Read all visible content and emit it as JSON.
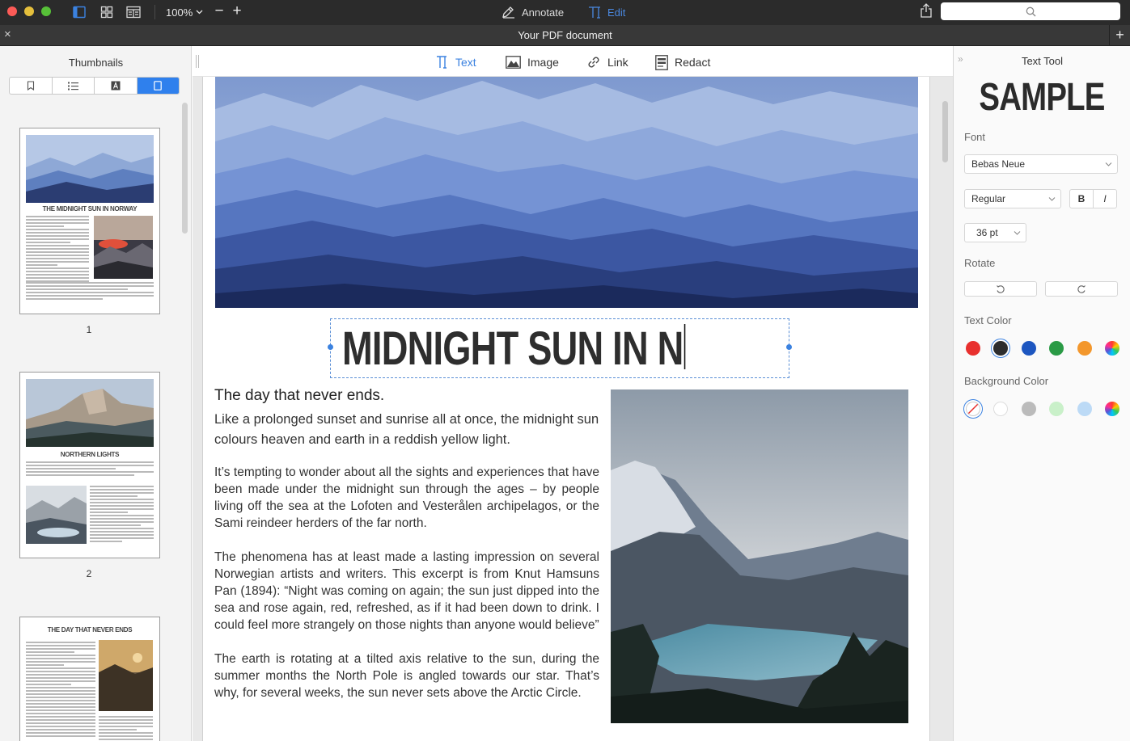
{
  "toolbar": {
    "zoom": "100%",
    "annotate_label": "Annotate",
    "edit_label": "Edit"
  },
  "tabbar": {
    "document_title": "Your PDF document"
  },
  "sidebar": {
    "title": "Thumbnails",
    "thumbnails": [
      {
        "number": "1",
        "heading": "THE MIDNIGHT SUN IN NORWAY"
      },
      {
        "number": "2",
        "heading": "NORTHERN LIGHTS"
      },
      {
        "heading": "THE DAY THAT NEVER ENDS"
      }
    ]
  },
  "edit_tools": {
    "text": "Text",
    "image": "Image",
    "link": "Link",
    "redact": "Redact"
  },
  "document": {
    "headline": "MIDNIGHT SUN IN N",
    "subheading": "The day that never ends.",
    "lead": "Like a prolonged sunset and sunrise all at once, the midnight sun colours heaven and earth in a reddish yellow light.",
    "paragraphs": [
      "It’s tempting to wonder about all the sights and experiences that have been made under the midnight sun through the ages – by people living off the sea at the Lofoten and Vesterålen archipelagos, or the Sami reindeer herders of the far north.",
      "The phenomena has at least made a lasting impression on several Norwegian artists and writers. This excerpt is from Knut Hamsuns Pan (1894): “Night was coming on again; the sun just dipped into the sea and rose again, red, refreshed, as if it had been down to drink. I could feel more strangely on those nights than anyone would believe”",
      "The earth is rotating at a tilted axis relative to the sun, during the summer months the North Pole is angled towards our star. That’s why, for several weeks, the sun never sets above the Arctic Circle."
    ]
  },
  "text_tool": {
    "title": "Text Tool",
    "sample": "SAMPLE",
    "font_label": "Font",
    "font_value": "Bebas Neue",
    "style_value": "Regular",
    "bold_label": "B",
    "italic_label": "I",
    "size_value": "36 pt",
    "rotate_label": "Rotate",
    "text_color_label": "Text Color",
    "background_color_label": "Background Color",
    "text_colors": [
      "#e8302e",
      "#2d2d2d",
      "#1d56c0",
      "#2a9a45",
      "#f3972c",
      "rainbow"
    ],
    "selected_text_color": "#2d2d2d",
    "background_colors": [
      "none",
      "#ffffff",
      "#bbbbbb",
      "#c9f0c9",
      "#bcdaf6",
      "rainbow"
    ],
    "selected_background_color": "none"
  }
}
